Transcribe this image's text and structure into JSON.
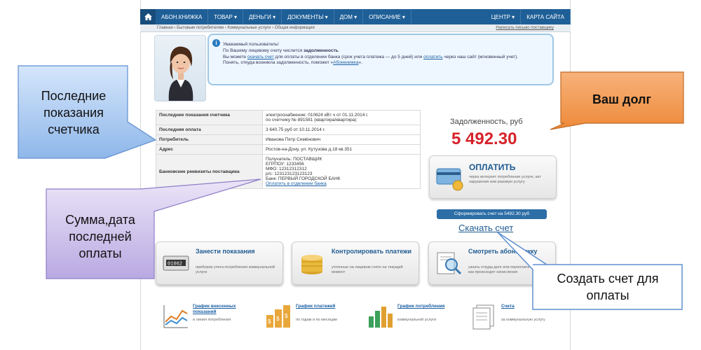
{
  "nav": {
    "items": [
      "АБОН.КНИЖКА",
      "ТОВАР ▾",
      "ДЕНЬГИ ▾",
      "ДОКУМЕНТЫ ▾",
      "ДОМ ▾",
      "ОПИСАНИЕ ▾"
    ],
    "right_items": [
      "ЦЕНТР ▾",
      "КАРТА САЙТА"
    ]
  },
  "breadcrumb": {
    "path": "Главная › Бытовым потребителям › Коммунальные услуги › Общая информация",
    "right_link": "Написать письмо поставщику"
  },
  "message": {
    "line1": "Уважаемый пользователь!",
    "line2_a": "По Вашему лицевому счету числится ",
    "line2_b": "задолженность",
    "line2_c": ".",
    "line3_a": "Вы можете ",
    "line3_link1": "скачать счет",
    "line3_b": " для оплаты в отделении банка (срок учета платежа — до 5 дней) или ",
    "line3_link2": "оплатить",
    "line3_c": " через наш сайт (мгновенный учет).",
    "line4_a": "Понять, откуда возникла задолженность, поможет «",
    "line4_link": "Абонкнижка",
    "line4_b": "»."
  },
  "table": {
    "rows": [
      {
        "key": "Последние показания счетчика",
        "v1": "электроснабжение: 010624 кВт·ч от 01.11.2014 г.",
        "v2": "по счетчику № 891581 (квартира/квартира)"
      },
      {
        "key": "Последняя оплата",
        "v1": "3 640.75 руб от 10.11.2014 г.",
        "v2": ""
      },
      {
        "key": "Потребитель",
        "v1": "Иванова Петр Семёнович",
        "v2": ""
      },
      {
        "key": "Адрес",
        "v1": "Ростов-на-Дону, ул. Кутузова д.18 кв.351",
        "v2": ""
      }
    ],
    "bank": {
      "key": "Банковские реквизиты поставщика",
      "lines": [
        "Получатель: ПОСТАВЩИК",
        "ЕГРПОУ: 1233456",
        "МФО: 12312312312",
        "р/с: 123123123123123",
        "Банк: ПЕРВЫЙ ГОРОДСКОЙ БАНК"
      ],
      "link": "Оплатить в отделении банка"
    }
  },
  "debt": {
    "label": "Задолженность, руб",
    "value": "5 492.30"
  },
  "pay": {
    "title": "ОПЛАТИТЬ",
    "desc": "через интернет потребление услуги, акт нарушения или разовую услугу"
  },
  "form_button": "Сформировать счет на 5492.30 руб",
  "download_link": "Скачать счет",
  "actions": [
    {
      "title": "Занести показания",
      "desc": "приборов учета потребления коммунальной услуги"
    },
    {
      "title": "Контролировать платежи",
      "desc": "учтенные на лицевом счете на текущий момент"
    },
    {
      "title": "Смотреть абонкнижку",
      "desc": "узнать откуда долг или переплата и увидеть как происходят начисления"
    }
  ],
  "bottom": [
    {
      "title": "График внесенных показаний",
      "desc": "и линия потребления"
    },
    {
      "title": "График платежей",
      "desc": "по годам и по месяцам"
    },
    {
      "title": "График потребления",
      "desc": "коммунальной услуги"
    },
    {
      "title": "Счета",
      "desc": "за коммунальную услугу"
    }
  ],
  "callouts": {
    "readings": "Последние показания счетчика",
    "debt": "Ваш долг",
    "payment": "Сумма,дата последней оплаты",
    "invoice": "Создать счет для оплаты"
  },
  "colors": {
    "nav": "#1f5f97",
    "debt": "#d6222a",
    "callout_blue": "#a9c8f0",
    "callout_orange": "#f2954a",
    "callout_purple": "#ccc0ea",
    "callout_white": "#ffffff"
  }
}
